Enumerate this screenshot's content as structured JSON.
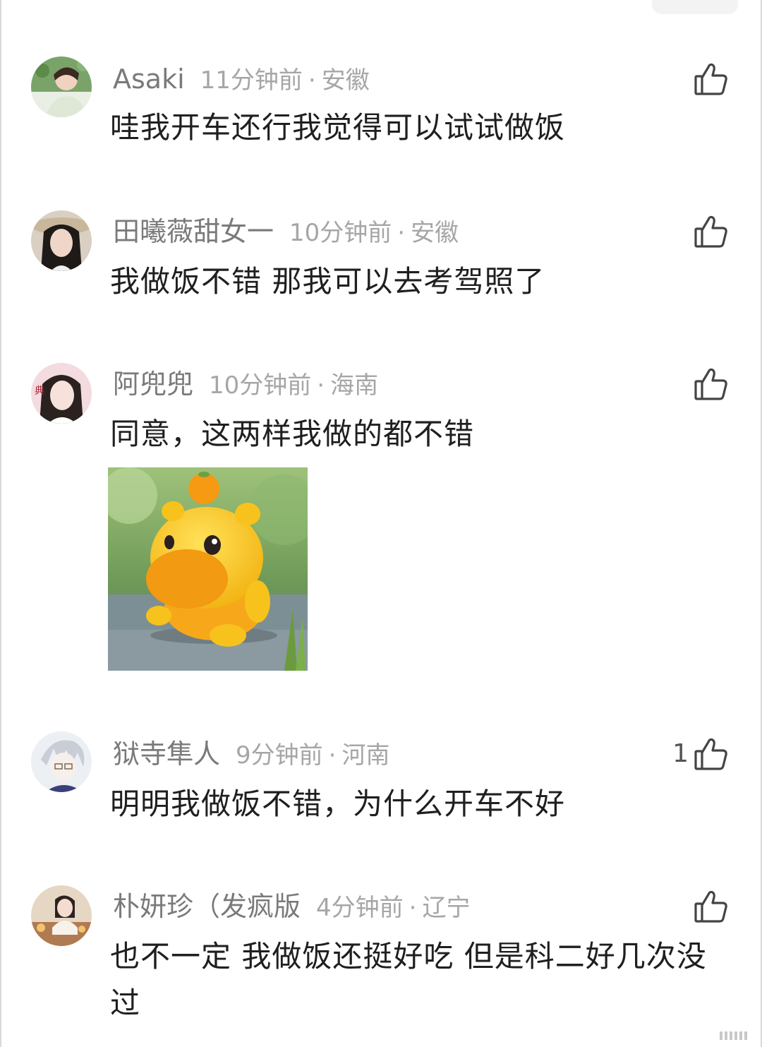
{
  "comments": [
    {
      "name": "Asaki",
      "time": "11分钟前",
      "dot": "·",
      "region": "安徽",
      "text": "哇我开车还行我觉得可以试试做饭",
      "likes": ""
    },
    {
      "name": "田曦薇甜女一",
      "time": "10分钟前",
      "dot": "·",
      "region": "安徽",
      "text": "我做饭不错 那我可以去考驾照了",
      "likes": ""
    },
    {
      "name": "阿兜兜",
      "time": "10分钟前",
      "dot": "·",
      "region": "海南",
      "text": "同意，这两样我做的都不错",
      "likes": "",
      "avatar_badge": "典"
    },
    {
      "name": "狱寺隼人",
      "time": "9分钟前",
      "dot": "·",
      "region": "河南",
      "text": "明明我做饭不错，为什么开车不好",
      "likes": "1"
    },
    {
      "name": "朴妍珍（发疯版",
      "time": "4分钟前",
      "dot": "·",
      "region": "辽宁",
      "text": "也不一定 我做饭还挺好吃 但是科二好几次没过",
      "likes": ""
    }
  ],
  "icons": {
    "like": "thumbs-up-icon"
  },
  "colors": {
    "name": "#7a7a7a",
    "meta": "#a6a6a6",
    "text": "#1f1f1f",
    "sticker_body": "#f7c21c",
    "sticker_snout": "#f29a12"
  }
}
